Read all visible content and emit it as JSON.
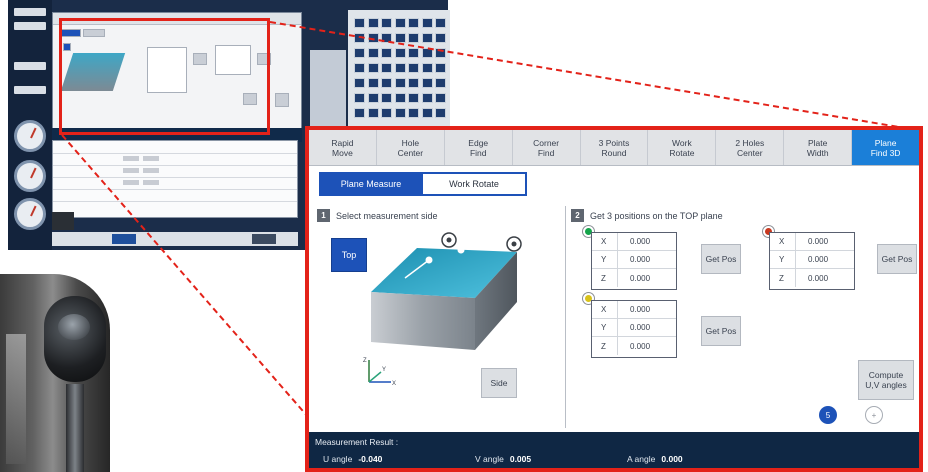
{
  "tabs": [
    {
      "label": "Rapid\nMove",
      "active": false
    },
    {
      "label": "Hole\nCenter",
      "active": false
    },
    {
      "label": "Edge\nFind",
      "active": false
    },
    {
      "label": "Corner\nFind",
      "active": false
    },
    {
      "label": "3 Points\nRound",
      "active": false
    },
    {
      "label": "Work\nRotate",
      "active": false
    },
    {
      "label": "2 Holes\nCenter",
      "active": false
    },
    {
      "label": "Plate\nWidth",
      "active": false
    },
    {
      "label": "Plane\nFind 3D",
      "active": true
    }
  ],
  "subtabs": {
    "plane_measure": "Plane Measure",
    "work_rotate": "Work Rotate"
  },
  "section1": {
    "number": "1",
    "title": "Select measurement side",
    "top_button": "Top",
    "side_button": "Side"
  },
  "section2": {
    "number": "2",
    "title": "Get 3 positions on the TOP plane"
  },
  "points": [
    {
      "color": "green",
      "x": "0.000",
      "y": "0.000",
      "z": "0.000",
      "button": "Get Pos"
    },
    {
      "color": "red",
      "x": "0.000",
      "y": "0.000",
      "z": "0.000",
      "button": "Get Pos"
    },
    {
      "color": "yellow",
      "x": "0.000",
      "y": "0.000",
      "z": "0.000",
      "button": "Get Pos"
    }
  ],
  "axis_labels": {
    "x": "X",
    "y": "Y",
    "z": "Z"
  },
  "compute_button": "Compute\nU,V angles",
  "page": {
    "current": "5",
    "add": "+"
  },
  "result": {
    "title": "Measurement Result :",
    "u_label": "U angle",
    "u_value": "-0.040",
    "v_label": "V angle",
    "v_value": "0.005",
    "a_label": "A angle",
    "a_value": "0.000"
  },
  "colors": {
    "accent": "#1d52b8",
    "active_tab": "#1b7fd8",
    "highlight_frame": "#e32219",
    "result_bar": "#0f2744"
  }
}
